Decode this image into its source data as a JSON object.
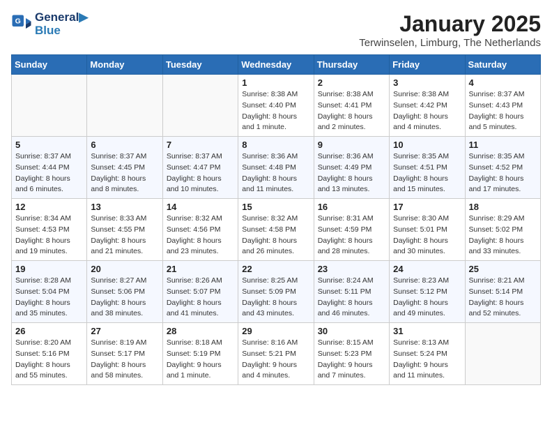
{
  "header": {
    "logo_line1": "General",
    "logo_line2": "Blue",
    "month_title": "January 2025",
    "location": "Terwinselen, Limburg, The Netherlands"
  },
  "days_of_week": [
    "Sunday",
    "Monday",
    "Tuesday",
    "Wednesday",
    "Thursday",
    "Friday",
    "Saturday"
  ],
  "weeks": [
    [
      {
        "day": "",
        "info": ""
      },
      {
        "day": "",
        "info": ""
      },
      {
        "day": "",
        "info": ""
      },
      {
        "day": "1",
        "info": "Sunrise: 8:38 AM\nSunset: 4:40 PM\nDaylight: 8 hours and 1 minute."
      },
      {
        "day": "2",
        "info": "Sunrise: 8:38 AM\nSunset: 4:41 PM\nDaylight: 8 hours and 2 minutes."
      },
      {
        "day": "3",
        "info": "Sunrise: 8:38 AM\nSunset: 4:42 PM\nDaylight: 8 hours and 4 minutes."
      },
      {
        "day": "4",
        "info": "Sunrise: 8:37 AM\nSunset: 4:43 PM\nDaylight: 8 hours and 5 minutes."
      }
    ],
    [
      {
        "day": "5",
        "info": "Sunrise: 8:37 AM\nSunset: 4:44 PM\nDaylight: 8 hours and 6 minutes."
      },
      {
        "day": "6",
        "info": "Sunrise: 8:37 AM\nSunset: 4:45 PM\nDaylight: 8 hours and 8 minutes."
      },
      {
        "day": "7",
        "info": "Sunrise: 8:37 AM\nSunset: 4:47 PM\nDaylight: 8 hours and 10 minutes."
      },
      {
        "day": "8",
        "info": "Sunrise: 8:36 AM\nSunset: 4:48 PM\nDaylight: 8 hours and 11 minutes."
      },
      {
        "day": "9",
        "info": "Sunrise: 8:36 AM\nSunset: 4:49 PM\nDaylight: 8 hours and 13 minutes."
      },
      {
        "day": "10",
        "info": "Sunrise: 8:35 AM\nSunset: 4:51 PM\nDaylight: 8 hours and 15 minutes."
      },
      {
        "day": "11",
        "info": "Sunrise: 8:35 AM\nSunset: 4:52 PM\nDaylight: 8 hours and 17 minutes."
      }
    ],
    [
      {
        "day": "12",
        "info": "Sunrise: 8:34 AM\nSunset: 4:53 PM\nDaylight: 8 hours and 19 minutes."
      },
      {
        "day": "13",
        "info": "Sunrise: 8:33 AM\nSunset: 4:55 PM\nDaylight: 8 hours and 21 minutes."
      },
      {
        "day": "14",
        "info": "Sunrise: 8:32 AM\nSunset: 4:56 PM\nDaylight: 8 hours and 23 minutes."
      },
      {
        "day": "15",
        "info": "Sunrise: 8:32 AM\nSunset: 4:58 PM\nDaylight: 8 hours and 26 minutes."
      },
      {
        "day": "16",
        "info": "Sunrise: 8:31 AM\nSunset: 4:59 PM\nDaylight: 8 hours and 28 minutes."
      },
      {
        "day": "17",
        "info": "Sunrise: 8:30 AM\nSunset: 5:01 PM\nDaylight: 8 hours and 30 minutes."
      },
      {
        "day": "18",
        "info": "Sunrise: 8:29 AM\nSunset: 5:02 PM\nDaylight: 8 hours and 33 minutes."
      }
    ],
    [
      {
        "day": "19",
        "info": "Sunrise: 8:28 AM\nSunset: 5:04 PM\nDaylight: 8 hours and 35 minutes."
      },
      {
        "day": "20",
        "info": "Sunrise: 8:27 AM\nSunset: 5:06 PM\nDaylight: 8 hours and 38 minutes."
      },
      {
        "day": "21",
        "info": "Sunrise: 8:26 AM\nSunset: 5:07 PM\nDaylight: 8 hours and 41 minutes."
      },
      {
        "day": "22",
        "info": "Sunrise: 8:25 AM\nSunset: 5:09 PM\nDaylight: 8 hours and 43 minutes."
      },
      {
        "day": "23",
        "info": "Sunrise: 8:24 AM\nSunset: 5:11 PM\nDaylight: 8 hours and 46 minutes."
      },
      {
        "day": "24",
        "info": "Sunrise: 8:23 AM\nSunset: 5:12 PM\nDaylight: 8 hours and 49 minutes."
      },
      {
        "day": "25",
        "info": "Sunrise: 8:21 AM\nSunset: 5:14 PM\nDaylight: 8 hours and 52 minutes."
      }
    ],
    [
      {
        "day": "26",
        "info": "Sunrise: 8:20 AM\nSunset: 5:16 PM\nDaylight: 8 hours and 55 minutes."
      },
      {
        "day": "27",
        "info": "Sunrise: 8:19 AM\nSunset: 5:17 PM\nDaylight: 8 hours and 58 minutes."
      },
      {
        "day": "28",
        "info": "Sunrise: 8:18 AM\nSunset: 5:19 PM\nDaylight: 9 hours and 1 minute."
      },
      {
        "day": "29",
        "info": "Sunrise: 8:16 AM\nSunset: 5:21 PM\nDaylight: 9 hours and 4 minutes."
      },
      {
        "day": "30",
        "info": "Sunrise: 8:15 AM\nSunset: 5:23 PM\nDaylight: 9 hours and 7 minutes."
      },
      {
        "day": "31",
        "info": "Sunrise: 8:13 AM\nSunset: 5:24 PM\nDaylight: 9 hours and 11 minutes."
      },
      {
        "day": "",
        "info": ""
      }
    ]
  ]
}
